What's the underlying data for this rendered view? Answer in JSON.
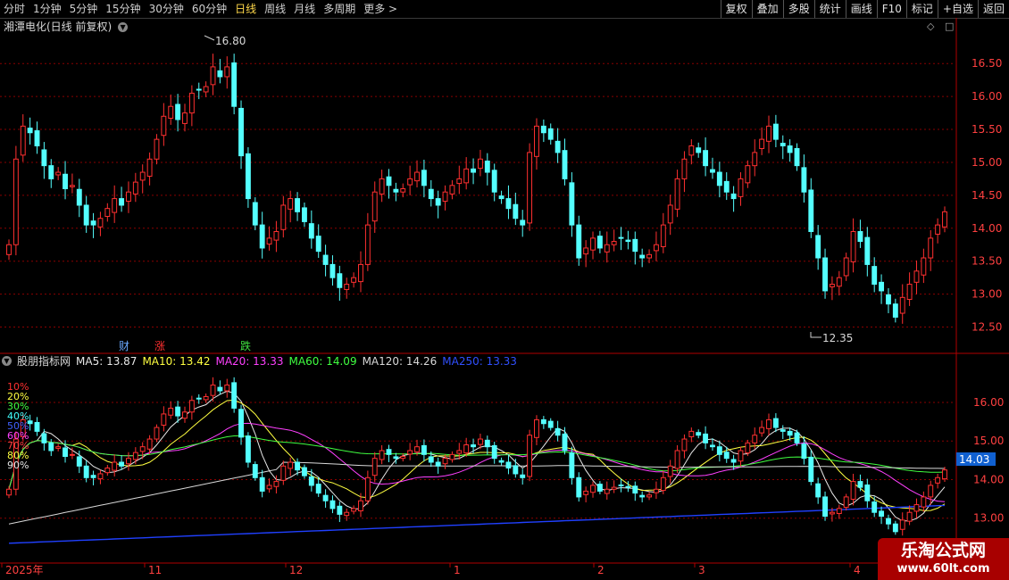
{
  "toolbar": {
    "periods": [
      "分时",
      "1分钟",
      "5分钟",
      "15分钟",
      "30分钟",
      "60分钟",
      "日线",
      "周线",
      "月线",
      "多周期",
      "更多 >"
    ],
    "active_period": "日线",
    "right_buttons": [
      "复权",
      "叠加",
      "多股",
      "统计",
      "画线",
      "F10",
      "标记",
      "+自选",
      "返回"
    ]
  },
  "main": {
    "stock_title": "湘潭电化(日线 前复权)",
    "price_labels": [
      "16.50",
      "16.00",
      "15.50",
      "15.00",
      "14.50",
      "14.00",
      "13.50",
      "13.00",
      "12.50"
    ],
    "high_label": "16.80",
    "low_label": "12.35",
    "event_markers": [
      {
        "text": "财",
        "color": "#6aa8ff"
      },
      {
        "text": "涨",
        "color": "#ff3030"
      },
      {
        "text": "跌",
        "color": "#40e040"
      }
    ]
  },
  "indicator": {
    "name": "股朋指标网",
    "ma": [
      {
        "label": "MA5: 13.87",
        "color": "#e8e8e8"
      },
      {
        "label": "MA10: 13.42",
        "color": "#ffff40"
      },
      {
        "label": "MA20: 13.33",
        "color": "#ff40ff"
      },
      {
        "label": "MA60: 14.09",
        "color": "#40ff40"
      },
      {
        "label": "MA120: 14.26",
        "color": "#d8d8d8"
      },
      {
        "label": "MA250: 13.33",
        "color": "#3050ff"
      }
    ],
    "percent_labels": [
      {
        "text": "10%",
        "color": "#ff3030"
      },
      {
        "text": "20%",
        "color": "#ffff40"
      },
      {
        "text": "30%",
        "color": "#40ff40"
      },
      {
        "text": "40%",
        "color": "#40ffff"
      },
      {
        "text": "50%",
        "color": "#4060ff"
      },
      {
        "text": "60%",
        "color": "#ff40ff"
      },
      {
        "text": "70%",
        "color": "#ff4040"
      },
      {
        "text": "80%",
        "color": "#ffff40"
      },
      {
        "text": "90%",
        "color": "#e8e8e8"
      }
    ],
    "price_labels": [
      "16.00",
      "15.00",
      "14.00",
      "13.00"
    ],
    "current_price": "14.03"
  },
  "xaxis": {
    "labels": [
      "2025年",
      "11",
      "12",
      "1",
      "2",
      "3",
      "4"
    ]
  },
  "badge": {
    "name": "乐淘公式网",
    "url": "www.60lt.com"
  },
  "colors": {
    "up": "#ff3030",
    "down": "#54ffff",
    "grid": "#8a0000",
    "axis": "#b00000"
  },
  "chart_data": {
    "type": "candlestick",
    "title": "湘潭电化(日线 前复权)",
    "high": 16.8,
    "low": 12.35,
    "ylim_main": [
      12.25,
      16.95
    ],
    "ylim_indicator": [
      12.6,
      16.6
    ],
    "series": [
      {
        "name": "MA5",
        "last": 13.87
      },
      {
        "name": "MA10",
        "last": 13.42
      },
      {
        "name": "MA20",
        "last": 13.33
      },
      {
        "name": "MA60",
        "last": 14.09
      },
      {
        "name": "MA120",
        "last": 14.26
      },
      {
        "name": "MA250",
        "last": 13.33
      }
    ],
    "closes": [
      13.75,
      15.05,
      15.55,
      15.45,
      15.25,
      14.95,
      14.75,
      14.85,
      14.6,
      14.65,
      14.35,
      14.05,
      14.05,
      14.15,
      14.3,
      14.45,
      14.35,
      14.55,
      14.7,
      14.85,
      15.05,
      15.35,
      15.7,
      15.85,
      15.65,
      15.75,
      16.05,
      16.1,
      16.15,
      16.45,
      16.3,
      16.45,
      15.85,
      15.1,
      14.45,
      14.05,
      13.7,
      13.85,
      13.95,
      14.35,
      14.45,
      14.25,
      14.1,
      13.85,
      13.65,
      13.45,
      13.25,
      13.1,
      13.15,
      13.25,
      13.45,
      14.05,
      14.55,
      14.75,
      14.65,
      14.55,
      14.6,
      14.75,
      14.85,
      14.65,
      14.45,
      14.35,
      14.55,
      14.65,
      14.75,
      14.9,
      14.85,
      15.05,
      14.85,
      14.55,
      14.45,
      14.3,
      14.15,
      14.05,
      15.15,
      15.55,
      15.45,
      15.35,
      15.15,
      14.75,
      14.05,
      13.55,
      13.7,
      13.85,
      13.7,
      13.75,
      13.8,
      13.85,
      13.8,
      13.65,
      13.55,
      13.6,
      13.75,
      14.05,
      14.35,
      14.75,
      15.05,
      15.25,
      15.15,
      14.95,
      14.85,
      14.65,
      14.55,
      14.45,
      14.75,
      14.95,
      15.15,
      15.35,
      15.55,
      15.35,
      15.25,
      15.15,
      14.95,
      14.55,
      13.95,
      13.55,
      13.05,
      13.15,
      13.25,
      13.55,
      13.95,
      13.8,
      13.45,
      13.15,
      13.05,
      12.85,
      12.65,
      12.95,
      13.15,
      13.35,
      13.55,
      13.85,
      14.05,
      14.25
    ]
  }
}
